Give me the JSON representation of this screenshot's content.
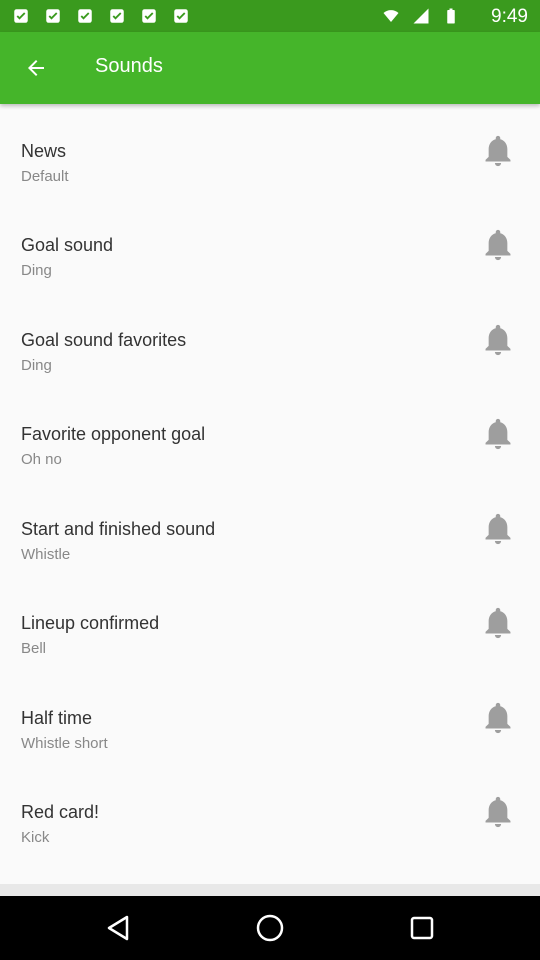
{
  "status_bar": {
    "time": "9:49"
  },
  "app_bar": {
    "title": "Sounds"
  },
  "items": [
    {
      "title": "News",
      "sound": "Default"
    },
    {
      "title": "Goal sound",
      "sound": "Ding"
    },
    {
      "title": "Goal sound favorites",
      "sound": "Ding"
    },
    {
      "title": "Favorite opponent goal",
      "sound": "Oh no"
    },
    {
      "title": "Start and finished sound",
      "sound": "Whistle"
    },
    {
      "title": "Lineup confirmed",
      "sound": "Bell"
    },
    {
      "title": "Half time",
      "sound": "Whistle short"
    },
    {
      "title": "Red card!",
      "sound": "Kick"
    }
  ],
  "colors": {
    "status_bar": "#3a9a1e",
    "app_bar": "#45b52a",
    "bell": "#9e9e9e"
  },
  "icons": {
    "back": "arrow-left-icon",
    "row": "bell-icon"
  }
}
